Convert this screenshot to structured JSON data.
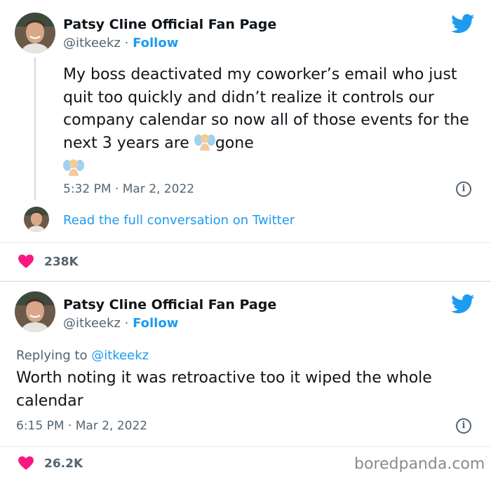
{
  "tweets": [
    {
      "author": {
        "name": "Patsy Cline Official Fan Page",
        "handle": "@itkeekz",
        "follow_label": "Follow"
      },
      "text_parts": [
        "My boss deactivated my coworker’s email who just quit too quickly and didn’t realize it controls our company calendar so now all of those events for the next 3 years are ",
        "gone"
      ],
      "emoji": "fairy-emoji",
      "timestamp": "5:32 PM · Mar 2, 2022",
      "read_full_label": "Read the full conversation on Twitter",
      "likes": "238K"
    },
    {
      "author": {
        "name": "Patsy Cline Official Fan Page",
        "handle": "@itkeekz",
        "follow_label": "Follow"
      },
      "replying_to_label": "Replying to",
      "replying_to_handle": "@itkeekz",
      "text": "Worth noting it was retroactive too it wiped the whole calendar",
      "timestamp": "6:15 PM · Mar 2, 2022",
      "likes": "26.2K"
    }
  ],
  "watermark": "boredpanda.com",
  "colors": {
    "twitter_blue": "#1d9bf0",
    "heart": "#f91880",
    "text": "#0f1419",
    "muted": "#536471"
  },
  "icons": [
    "twitter-bird-icon",
    "info-icon",
    "heart-icon"
  ]
}
